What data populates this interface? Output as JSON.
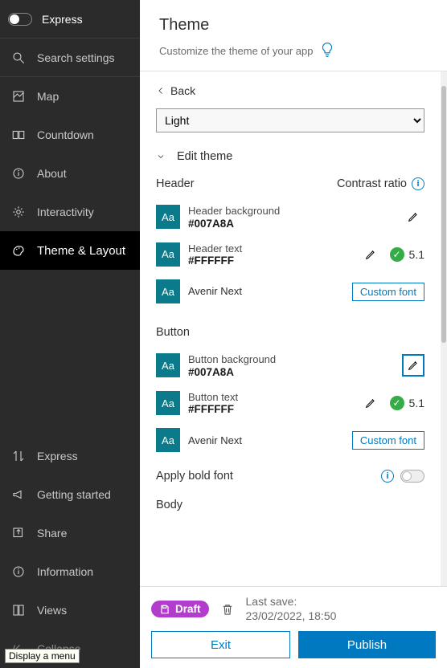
{
  "sidebar": {
    "express_label": "Express",
    "search_placeholder": "Search settings",
    "items": [
      {
        "label": "Map"
      },
      {
        "label": "Countdown"
      },
      {
        "label": "About"
      },
      {
        "label": "Interactivity"
      },
      {
        "label": "Theme & Layout"
      }
    ],
    "bottom": [
      {
        "label": "Express"
      },
      {
        "label": "Getting started"
      },
      {
        "label": "Share"
      },
      {
        "label": "Information"
      },
      {
        "label": "Views"
      },
      {
        "label": "Collapse"
      }
    ]
  },
  "header": {
    "title": "Theme",
    "subtitle": "Customize the theme of your app"
  },
  "content": {
    "back_label": "Back",
    "theme_selected": "Light",
    "edit_theme_label": "Edit theme",
    "sections": {
      "header_title": "Header",
      "button_title": "Button",
      "body_title": "Body"
    },
    "contrast_ratio_label": "Contrast ratio",
    "swatch_text": "Aa",
    "header_bg": {
      "label": "Header background",
      "value": "#007A8A"
    },
    "header_text": {
      "label": "Header text",
      "value": "#FFFFFF",
      "ratio": "5.1"
    },
    "header_font": {
      "label": "Avenir Next"
    },
    "button_bg": {
      "label": "Button background",
      "value": "#007A8A"
    },
    "button_text": {
      "label": "Button text",
      "value": "#FFFFFF",
      "ratio": "5.1"
    },
    "button_font": {
      "label": "Avenir Next"
    },
    "custom_font_label": "Custom font",
    "bold_label": "Apply bold font"
  },
  "footer": {
    "draft_label": "Draft",
    "last_save_label": "Last save:",
    "last_save_value": "23/02/2022, 18:50",
    "exit_label": "Exit",
    "publish_label": "Publish"
  },
  "tooltip": "Display a menu",
  "colors": {
    "swatch": "#0B7A8A",
    "accent": "#0079c1"
  }
}
